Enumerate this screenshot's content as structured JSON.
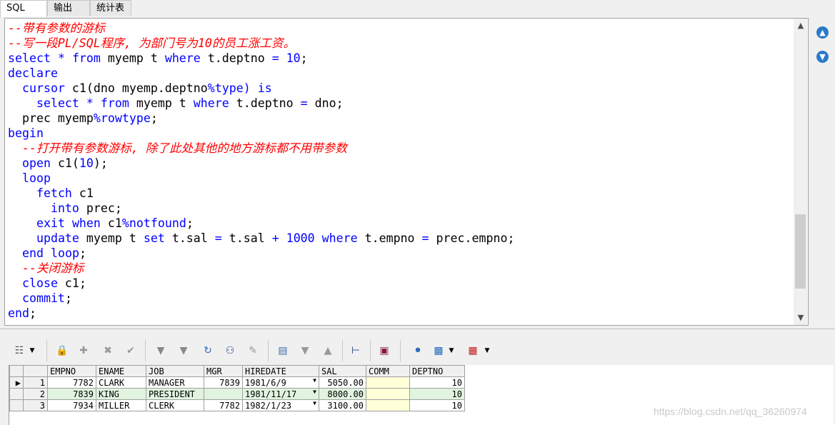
{
  "tabs": [
    "SQL",
    "输出",
    "统计表"
  ],
  "code_lines": [
    [
      {
        "t": "--带有参数的游标",
        "c": "cm"
      }
    ],
    [
      {
        "t": "--写一段PL/SQL程序, 为部门号为10的员工涨工资。",
        "c": "cm"
      }
    ],
    [
      {
        "t": "select",
        "c": "kw"
      },
      {
        "t": " * ",
        "c": "kw"
      },
      {
        "t": "from",
        "c": "kw"
      },
      {
        "t": " myemp t ",
        "c": "pl"
      },
      {
        "t": "where",
        "c": "kw"
      },
      {
        "t": " t.deptno ",
        "c": "pl"
      },
      {
        "t": "=",
        "c": "kw"
      },
      {
        "t": " ",
        "c": "pl"
      },
      {
        "t": "10",
        "c": "kw"
      },
      {
        "t": ";",
        "c": "pl"
      }
    ],
    [
      {
        "t": "declare",
        "c": "kw"
      }
    ],
    [
      {
        "t": "  ",
        "c": "pl"
      },
      {
        "t": "cursor",
        "c": "kw"
      },
      {
        "t": " c1(dno myemp.deptno",
        "c": "pl"
      },
      {
        "t": "%type)",
        "c": "kw"
      },
      {
        "t": " ",
        "c": "pl"
      },
      {
        "t": "is",
        "c": "kw"
      }
    ],
    [
      {
        "t": "    ",
        "c": "pl"
      },
      {
        "t": "select",
        "c": "kw"
      },
      {
        "t": " * ",
        "c": "kw"
      },
      {
        "t": "from",
        "c": "kw"
      },
      {
        "t": " myemp t ",
        "c": "pl"
      },
      {
        "t": "where",
        "c": "kw"
      },
      {
        "t": " t.deptno ",
        "c": "pl"
      },
      {
        "t": "=",
        "c": "kw"
      },
      {
        "t": " dno;",
        "c": "pl"
      }
    ],
    [
      {
        "t": "  prec myemp",
        "c": "pl"
      },
      {
        "t": "%rowtype",
        "c": "kw"
      },
      {
        "t": ";",
        "c": "pl"
      }
    ],
    [
      {
        "t": "begin",
        "c": "kw"
      }
    ],
    [
      {
        "t": "  ",
        "c": "pl"
      },
      {
        "t": "--打开带有参数游标, 除了此处其他的地方游标都不用带参数",
        "c": "cm"
      }
    ],
    [
      {
        "t": "  ",
        "c": "pl"
      },
      {
        "t": "open",
        "c": "kw"
      },
      {
        "t": " c1(",
        "c": "pl"
      },
      {
        "t": "10",
        "c": "kw"
      },
      {
        "t": ");",
        "c": "pl"
      }
    ],
    [
      {
        "t": "  ",
        "c": "pl"
      },
      {
        "t": "loop",
        "c": "kw"
      }
    ],
    [
      {
        "t": "    ",
        "c": "pl"
      },
      {
        "t": "fetch",
        "c": "kw"
      },
      {
        "t": " c1",
        "c": "pl"
      }
    ],
    [
      {
        "t": "      ",
        "c": "pl"
      },
      {
        "t": "into",
        "c": "kw"
      },
      {
        "t": " prec;",
        "c": "pl"
      }
    ],
    [
      {
        "t": "    ",
        "c": "pl"
      },
      {
        "t": "exit",
        "c": "kw"
      },
      {
        "t": " ",
        "c": "pl"
      },
      {
        "t": "when",
        "c": "kw"
      },
      {
        "t": " c1",
        "c": "pl"
      },
      {
        "t": "%notfound",
        "c": "kw"
      },
      {
        "t": ";",
        "c": "pl"
      }
    ],
    [
      {
        "t": "    ",
        "c": "pl"
      },
      {
        "t": "update",
        "c": "kw"
      },
      {
        "t": " myemp t ",
        "c": "pl"
      },
      {
        "t": "set",
        "c": "kw"
      },
      {
        "t": " t.sal ",
        "c": "pl"
      },
      {
        "t": "=",
        "c": "kw"
      },
      {
        "t": " t.sal ",
        "c": "pl"
      },
      {
        "t": "+",
        "c": "kw"
      },
      {
        "t": " ",
        "c": "pl"
      },
      {
        "t": "1000",
        "c": "kw"
      },
      {
        "t": " ",
        "c": "pl"
      },
      {
        "t": "where",
        "c": "kw"
      },
      {
        "t": " t.empno ",
        "c": "pl"
      },
      {
        "t": "=",
        "c": "kw"
      },
      {
        "t": " prec.empno;",
        "c": "pl"
      }
    ],
    [
      {
        "t": "  ",
        "c": "pl"
      },
      {
        "t": "end",
        "c": "kw"
      },
      {
        "t": " ",
        "c": "pl"
      },
      {
        "t": "loop",
        "c": "kw"
      },
      {
        "t": ";",
        "c": "pl"
      }
    ],
    [
      {
        "t": "  ",
        "c": "pl"
      },
      {
        "t": "--关闭游标",
        "c": "cm"
      }
    ],
    [
      {
        "t": "  ",
        "c": "pl"
      },
      {
        "t": "close",
        "c": "kw"
      },
      {
        "t": " c1;",
        "c": "pl"
      }
    ],
    [
      {
        "t": "  ",
        "c": "pl"
      },
      {
        "t": "commit",
        "c": "kw"
      },
      {
        "t": ";",
        "c": "pl"
      }
    ],
    [
      {
        "t": "end",
        "c": "kw"
      },
      {
        "t": ";",
        "c": "pl"
      }
    ]
  ],
  "colors": {
    "keyword": "#0000ff",
    "comment": "#ff0000",
    "plain": "#000000",
    "alt_row": "#e0f4e0",
    "comm_cell": "#ffffd8"
  },
  "side_buttons": [
    "arrow-up-circle-icon",
    "arrow-down-circle-icon"
  ],
  "toolbar_icons": [
    "grid-options-icon",
    "lock-icon",
    "new-record-icon",
    "delete-record-icon",
    "post-check-icon",
    "first-record-icon",
    "last-record-icon",
    "refresh-icon",
    "search-binoculars-icon",
    "clear-eraser-icon",
    "sheet-icon",
    "next-arrow-icon",
    "prev-arrow-icon",
    "query-tree-icon",
    "save-icon",
    "db-export-icon",
    "chart-icon",
    "table-grid-icon"
  ],
  "grid": {
    "columns": [
      "EMPNO",
      "ENAME",
      "JOB",
      "MGR",
      "HIREDATE",
      "SAL",
      "COMM",
      "DEPTNO"
    ],
    "rows": [
      {
        "num": "1",
        "EMPNO": "7782",
        "ENAME": "CLARK",
        "JOB": "MANAGER",
        "MGR": "7839",
        "HIREDATE": "1981/6/9",
        "SAL": "5050.00",
        "COMM": "",
        "DEPTNO": "10"
      },
      {
        "num": "2",
        "EMPNO": "7839",
        "ENAME": "KING",
        "JOB": "PRESIDENT",
        "MGR": "",
        "HIREDATE": "1981/11/17",
        "SAL": "8000.00",
        "COMM": "",
        "DEPTNO": "10"
      },
      {
        "num": "3",
        "EMPNO": "7934",
        "ENAME": "MILLER",
        "JOB": "CLERK",
        "MGR": "7782",
        "HIREDATE": "1982/1/23",
        "SAL": "3100.00",
        "COMM": "",
        "DEPTNO": "10"
      }
    ]
  },
  "watermark": "https://blog.csdn.net/qq_36260974"
}
